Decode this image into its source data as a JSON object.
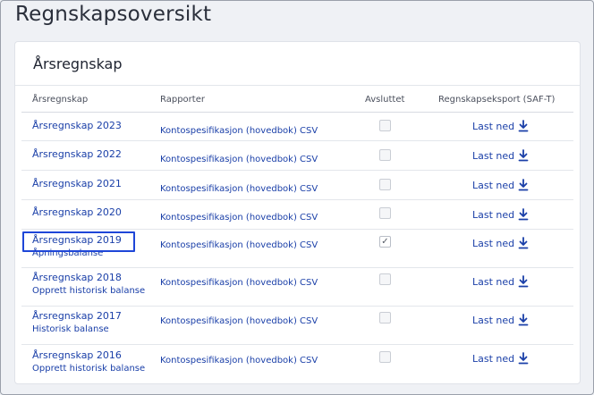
{
  "page": {
    "title": "Regnskapsoversikt"
  },
  "card": {
    "title": "Årsregnskap"
  },
  "table": {
    "headers": {
      "year": "Årsregnskap",
      "reports": "Rapporter",
      "closed": "Avsluttet",
      "saft": "Regnskapseksport (SAF-T)"
    },
    "rows": [
      {
        "year": "Årsregnskap 2023",
        "sub": "",
        "report": "Kontospesifikasjon (hovedbok) CSV",
        "closed": false,
        "download": "Last ned"
      },
      {
        "year": "Årsregnskap 2022",
        "sub": "",
        "report": "Kontospesifikasjon (hovedbok) CSV",
        "closed": false,
        "download": "Last ned"
      },
      {
        "year": "Årsregnskap 2021",
        "sub": "",
        "report": "Kontospesifikasjon (hovedbok) CSV",
        "closed": false,
        "download": "Last ned"
      },
      {
        "year": "Årsregnskap 2020",
        "sub": "",
        "report": "Kontospesifikasjon (hovedbok) CSV",
        "closed": false,
        "download": "Last ned"
      },
      {
        "year": "Årsregnskap 2019",
        "sub": "Åpningsbalanse",
        "report": "Kontospesifikasjon (hovedbok) CSV",
        "closed": true,
        "download": "Last ned"
      },
      {
        "year": "Årsregnskap 2018",
        "sub": "Opprett historisk balanse",
        "report": "Kontospesifikasjon (hovedbok) CSV",
        "closed": false,
        "download": "Last ned"
      },
      {
        "year": "Årsregnskap 2017",
        "sub": "Historisk balanse",
        "report": "Kontospesifikasjon (hovedbok) CSV",
        "closed": false,
        "download": "Last ned"
      },
      {
        "year": "Årsregnskap 2016",
        "sub": "Opprett historisk balanse",
        "report": "Kontospesifikasjon (hovedbok) CSV",
        "closed": false,
        "download": "Last ned"
      }
    ],
    "checkmark_glyph": "✓"
  },
  "colors": {
    "link": "#1a3fa8",
    "focus": "#1e46d8",
    "background": "#eff1f5"
  }
}
